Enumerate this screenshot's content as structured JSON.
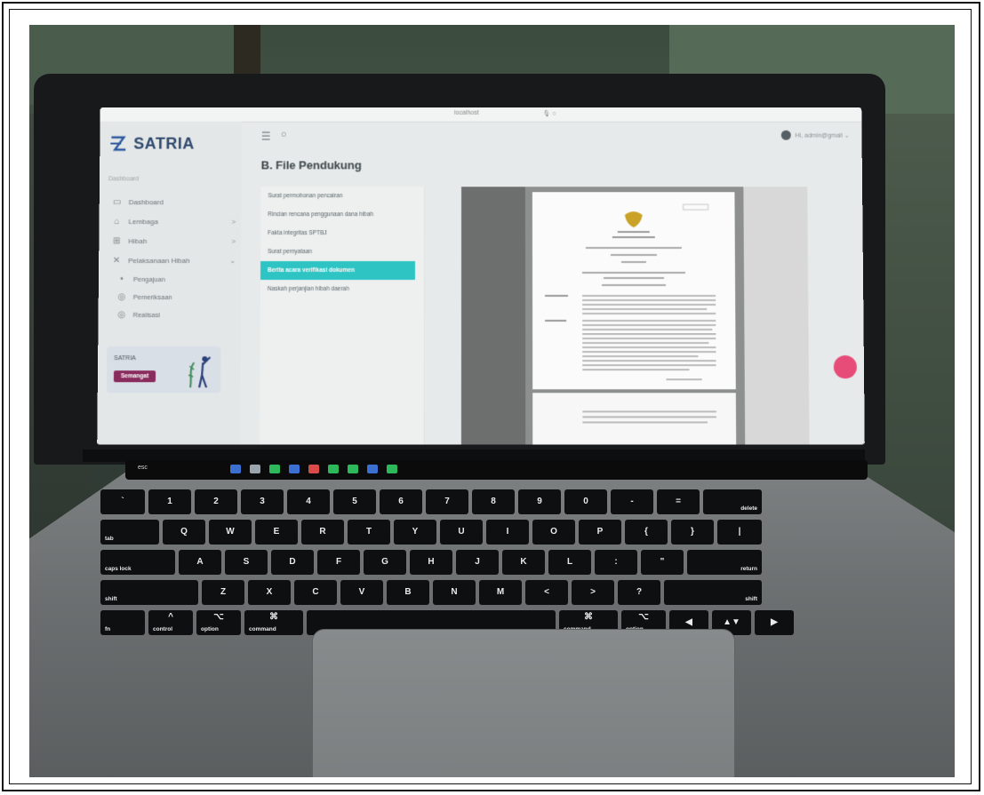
{
  "browser": {
    "url": "localhost",
    "mic": "🎙 ○"
  },
  "sidebar": {
    "logo_text": "SATRIA",
    "section_label": "Dashboard",
    "items": [
      {
        "label": "Dashboard",
        "icon": "monitor-icon"
      },
      {
        "label": "Lembaga",
        "icon": "bank-icon",
        "chevron": ">"
      },
      {
        "label": "Hibah",
        "icon": "gift-icon",
        "chevron": ">"
      },
      {
        "label": "Pelaksanaan Hibah",
        "icon": "tools-icon",
        "chevron": "⌄"
      }
    ],
    "subitems": [
      {
        "label": "Pengajuan",
        "bullet": "•"
      },
      {
        "label": "Pemeriksaan",
        "bullet": "◎"
      },
      {
        "label": "Realisasi",
        "bullet": "◎"
      }
    ],
    "promo": {
      "title": "SATRIA",
      "button": "Semangat"
    }
  },
  "topbar": {
    "user_label": "Hi, admin@gmail ⌄"
  },
  "main": {
    "title": "B. File Pendukung",
    "files": [
      "Surat permohonan pencairan",
      "Rincian rencana penggunaan dana hibah",
      "Fakta integritas SPTBJ",
      "Surat pernyataan",
      "Berita acara verifikasi dokumen",
      "Naskah perjanjian hibah daerah"
    ],
    "active_index": 4
  },
  "keyboard": {
    "touchbar_esc": "esc",
    "rows": [
      [
        {
          "top": "~",
          "bot": "`"
        },
        {
          "top": "!",
          "bot": "1"
        },
        {
          "top": "@",
          "bot": "2"
        },
        {
          "top": "#",
          "bot": "3"
        },
        {
          "top": "$",
          "bot": "4"
        },
        {
          "top": "%",
          "bot": "5"
        },
        {
          "top": "^",
          "bot": "6"
        },
        {
          "top": "&",
          "bot": "7"
        },
        {
          "top": "*",
          "bot": "8"
        },
        {
          "top": "(",
          "bot": "9"
        },
        {
          "top": ")",
          "bot": "0"
        },
        {
          "top": "_",
          "bot": "-"
        },
        {
          "top": "+",
          "bot": "="
        },
        {
          "top": "",
          "bot": "delete"
        }
      ],
      [
        "tab",
        "Q",
        "W",
        "E",
        "R",
        "T",
        "Y",
        "U",
        "I",
        "O",
        "P",
        "{",
        "}",
        "|"
      ],
      [
        "caps lock",
        "A",
        "S",
        "D",
        "F",
        "G",
        "H",
        "J",
        "K",
        "L",
        ":",
        "\"",
        "return"
      ],
      [
        "shift",
        "Z",
        "X",
        "C",
        "V",
        "B",
        "N",
        "M",
        "<",
        ">",
        "?",
        "shift"
      ],
      [
        "fn",
        "control",
        "option",
        "command",
        "",
        "command",
        "option",
        "◀",
        "▲▼",
        "▶"
      ]
    ],
    "mod_symbols": {
      "control": "^",
      "option": "⌥",
      "command": "⌘"
    }
  }
}
